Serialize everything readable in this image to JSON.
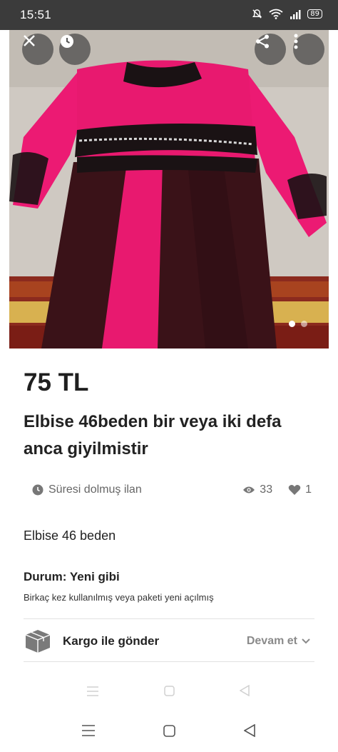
{
  "status_bar": {
    "time": "15:51",
    "battery": "89"
  },
  "photo": {
    "image_count": 2,
    "active_index": 0
  },
  "listing": {
    "price": "75 TL",
    "title": "Elbise 46beden bir veya iki defa anca giyilmistir",
    "status_text": "Süresi dolmuş ilan",
    "views": "33",
    "likes": "1",
    "description": "Elbise 46 beden",
    "condition_label": "Durum: Yeni gibi",
    "condition_description": "Birkaç kez kullanılmış veya paketi yeni açılmış",
    "shipping_label": "Kargo ile gönder",
    "shipping_action": "Devam et"
  },
  "icons": {
    "close": "close-icon",
    "history": "clock-icon",
    "share": "share-icon",
    "more": "more-vert-icon",
    "status": "clock-icon",
    "views": "eye-icon",
    "likes": "heart-icon",
    "shipping": "box-icon",
    "chevron": "chevron-down-icon",
    "menu": "menu-icon",
    "home": "square-icon",
    "back": "back-triangle-icon"
  },
  "colors": {
    "accent_pink": "#e8196f",
    "text": "#222222",
    "muted": "#666666",
    "status_bar": "#3b3b3b"
  }
}
